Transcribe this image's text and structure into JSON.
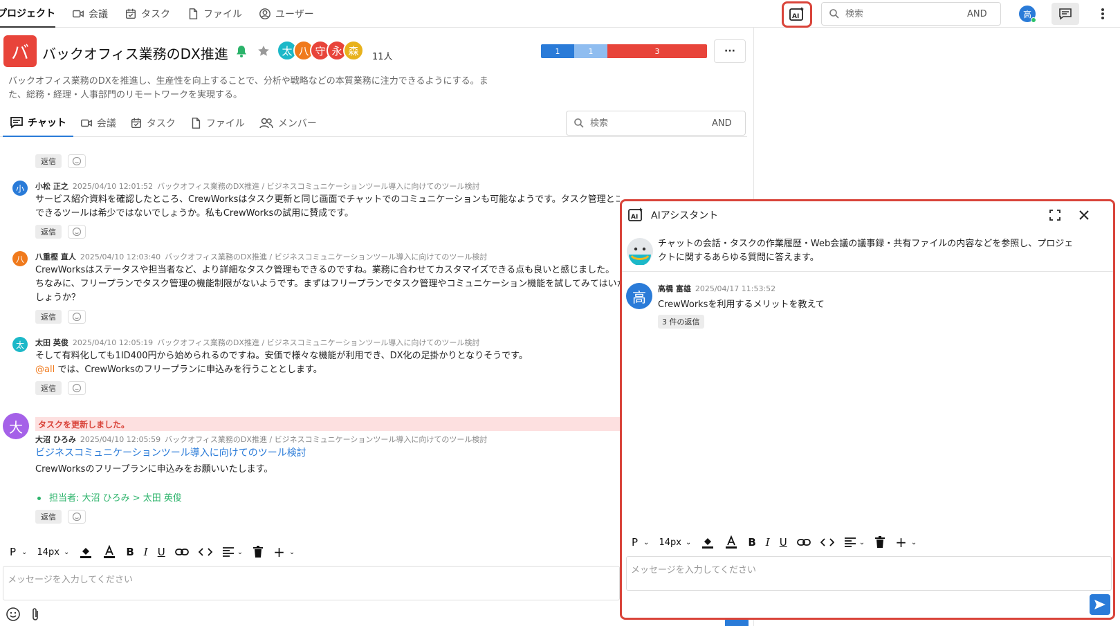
{
  "top_nav": {
    "items": [
      {
        "label": "プロジェクト",
        "icon": "folder-icon"
      },
      {
        "label": "会議",
        "icon": "video-icon"
      },
      {
        "label": "タスク",
        "icon": "calendar-check-icon"
      },
      {
        "label": "ファイル",
        "icon": "file-icon"
      },
      {
        "label": "ユーザー",
        "icon": "user-circle-icon"
      }
    ],
    "search_placeholder": "検索",
    "search_and": "AND",
    "user_avatar": "高"
  },
  "project": {
    "avatar_letter": "バ",
    "title": "バックオフィス業務のDX推進",
    "members": [
      "太",
      "八",
      "守",
      "永",
      "森"
    ],
    "member_count": "11人",
    "progress": [
      {
        "label": "1",
        "fraction": 0.2,
        "color": "#2a7bd8"
      },
      {
        "label": "1",
        "fraction": 0.2,
        "color": "#8fbdf0"
      },
      {
        "label": "3",
        "fraction": 0.6,
        "color": "#e8443a"
      }
    ],
    "more_label": "···",
    "description_line1": "バックオフィス業務のDXを推進し、生産性を向上することで、分析や戦略などの本質業務に注力できるようにする。ま",
    "description_line2": "た、総務・経理・人事部門のリモートワークを実現する。"
  },
  "tabs": [
    {
      "label": "チャット",
      "icon": "chat-icon"
    },
    {
      "label": "会議",
      "icon": "video-icon"
    },
    {
      "label": "タスク",
      "icon": "calendar-check-icon"
    },
    {
      "label": "ファイル",
      "icon": "file-icon"
    },
    {
      "label": "メンバー",
      "icon": "users-icon"
    }
  ],
  "tab_search": {
    "placeholder": "検索",
    "and": "AND"
  },
  "messages": [
    {
      "avatar": "小",
      "avatar_color": "#2a7bd8",
      "name": "小松 正之",
      "time": "2025/04/10 12:01:52",
      "path": "バックオフィス業務のDX推進 / ビジネスコミュニケーションツール導入に向けてのツール検討",
      "lines": [
        "サービス紹介資料を確認したところ、CrewWorksはタスク更新と同じ画面でチャットでのコミュニケーションも可能なようです。タスク管理とコミュニケーションを一元管理",
        "できるツールは希少ではないでしょうか。私もCrewWorksの試用に賛成です。"
      ]
    },
    {
      "avatar": "八",
      "avatar_color": "#f07a1c",
      "name": "八重樫 直人",
      "time": "2025/04/10 12:03:40",
      "path": "バックオフィス業務のDX推進 / ビジネスコミュニケーションツール導入に向けてのツール検討",
      "lines": [
        "CrewWorksはステータスや担当者など、より詳細なタスク管理もできるのですね。業務に合わせてカスタマイズできる点も良いと感じました。",
        "ちなみに、フリープランでタスク管理の機能制限がないようです。まずはフリープランでタスク管理やコミュニケーション機能を試してみてはいかがで",
        "しょうか？"
      ]
    },
    {
      "avatar": "太",
      "avatar_color": "#1cb8c8",
      "name": "太田 英俊",
      "time": "2025/04/10 12:05:19",
      "path": "バックオフィス業務のDX推進 / ビジネスコミュニケーションツール導入に向けてのツール検討",
      "line1": "そして有料化しても1ID400円から始められるのですね。安価で様々な機能が利用でき、DX化の足掛かりとなりそうです。",
      "mention": "@all",
      "line2": " では、CrewWorksのフリープランに申込みを行うこととします。"
    }
  ],
  "task_update": {
    "banner": "タスクを更新しました。",
    "avatar": "大",
    "avatar_color": "#a561e8",
    "name": "大沼 ひろみ",
    "time": "2025/04/10 12:05:59",
    "path": "バックオフィス業務のDX推進 / ビジネスコミュニケーションツール導入に向けてのツール検討",
    "link": "ビジネスコミュニケーションツール導入に向けてのツール検討",
    "body": "CrewWorksのフリープランに申込みをお願いいたします。",
    "assignee": "担当者: 大沼 ひろみ > 太田 英俊"
  },
  "reply_label": "返信",
  "editor": {
    "para": "P",
    "size": "14px",
    "placeholder": "メッセージを入力してください"
  },
  "ai_panel": {
    "title": "AIアシスタント",
    "intro_line1": "チャットの会話・タスクの作業履歴・Web会議の議事録・共有ファイルの内容などを参照し、プロジェ",
    "intro_line2": "クトに関するあらゆる質問に答えます。",
    "message": {
      "avatar": "高",
      "name": "高橋 富雄",
      "time": "2025/04/17 11:53:52",
      "text": "CrewWorksを利用するメリットを教えて",
      "replies": "3 件の返信"
    },
    "editor_placeholder": "メッセージを入力してください"
  }
}
